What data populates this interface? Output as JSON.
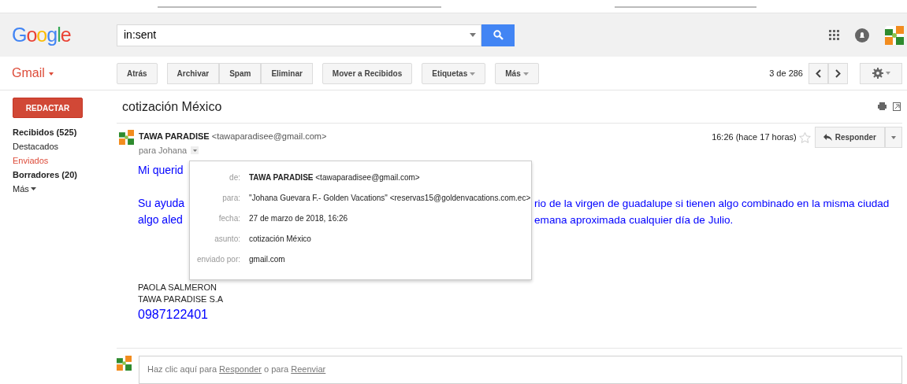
{
  "header": {
    "logo": "Google",
    "search": {
      "value": "in:sent"
    }
  },
  "toolbar": {
    "app_label": "Gmail",
    "button_groups": [
      [
        {
          "label": "Atrás",
          "dropdown": false
        }
      ],
      [
        {
          "label": "Archivar",
          "dropdown": false
        },
        {
          "label": "Spam",
          "dropdown": false
        },
        {
          "label": "Eliminar",
          "dropdown": false
        }
      ],
      [
        {
          "label": "Mover a Recibidos",
          "dropdown": false
        }
      ],
      [
        {
          "label": "Etiquetas",
          "dropdown": true
        }
      ],
      [
        {
          "label": "Más",
          "dropdown": true
        }
      ]
    ],
    "pager": "3 de 286"
  },
  "sidebar": {
    "compose": "REDACTAR",
    "items": [
      {
        "label": "Recibidos (525)",
        "selected": false,
        "bold": true
      },
      {
        "label": "Destacados",
        "selected": false,
        "bold": false
      },
      {
        "label": "Enviados",
        "selected": true,
        "bold": false
      },
      {
        "label": "Borradores (20)",
        "selected": false,
        "bold": true
      }
    ],
    "more": "Más"
  },
  "message": {
    "subject": "cotización México",
    "sender_name": "TAWA PARADISE",
    "sender_email": "<tawaparadisee@gmail.com>",
    "to": "para Johana",
    "time": "16:26 (hace 17 horas)",
    "starred": false,
    "reply": "Responder",
    "body": [
      {
        "left": "Mi querid"
      },
      {
        "left": "Su ayuda",
        "right": "rio de la virgen de guadalupe si tienen algo combinado en la misma ciudad"
      },
      {
        "left": "algo aled",
        "right": "emana aproximada cualquier día de Julio."
      }
    ],
    "signature": [
      "PAOLA SALMERON",
      "TAWA PARADISE S.A"
    ],
    "phone": "0987122401",
    "details": [
      {
        "label": "de:",
        "value": "**TAWA PARADISE** <tawaparadisee@gmail.com>"
      },
      {
        "label": "para:",
        "value": "\"Johana Guevara F.- Golden Vacations\" <reservas15@goldenvacations.com.ec>"
      },
      {
        "label": "fecha:",
        "value": "27 de marzo de 2018, 16:26"
      },
      {
        "label": "asunto:",
        "value": "cotización México"
      },
      {
        "label": "enviado por:",
        "value": "gmail.com"
      }
    ]
  },
  "reply_box": {
    "prefix": "Haz clic aquí para",
    "reply_link": "Responder",
    "middle": "o para",
    "forward_link": "Reenviar"
  }
}
